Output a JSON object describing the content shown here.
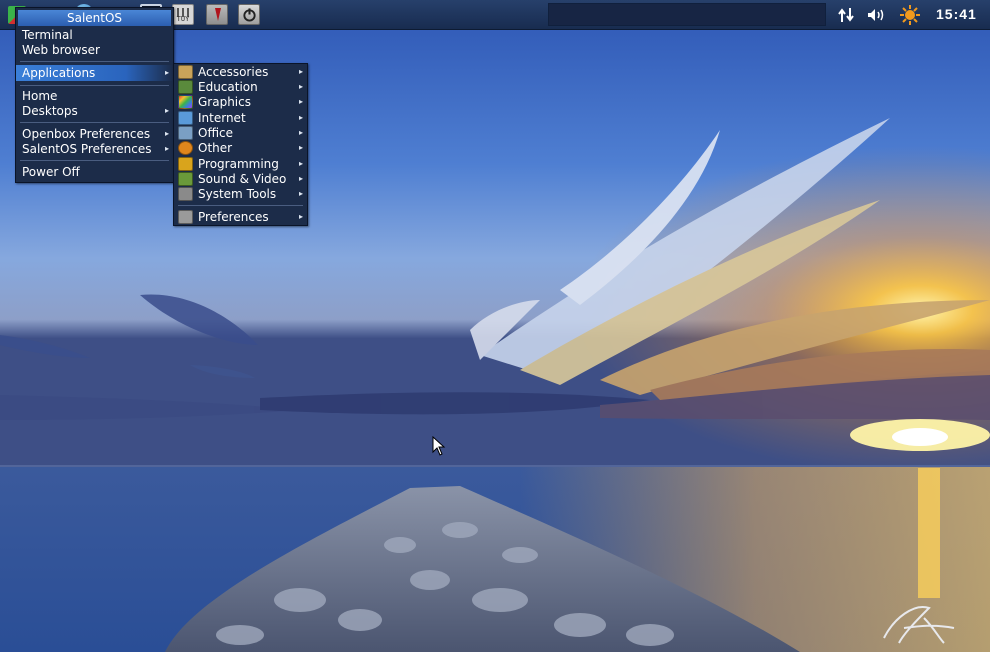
{
  "panel": {
    "launchers": [
      {
        "name": "salentos-logo-icon"
      },
      {
        "name": "web-browser-icon"
      },
      {
        "name": "terminal-icon"
      },
      {
        "name": "tuy-icon",
        "label": "TUY"
      },
      {
        "name": "tie-icon"
      },
      {
        "name": "power-icon"
      }
    ],
    "tray": {
      "network_icon": "network-arrows-icon",
      "volume_icon": "volume-icon",
      "update_icon": "sun-update-icon"
    },
    "clock": "15:41"
  },
  "root_menu": {
    "title": "SalentOS",
    "items": [
      {
        "label": "Terminal",
        "submenu": false
      },
      {
        "label": "Web browser",
        "submenu": false
      },
      {
        "label": "Applications",
        "submenu": true,
        "active": true
      },
      {
        "label": "Home",
        "submenu": false
      },
      {
        "label": "Desktops",
        "submenu": true
      },
      {
        "label": "Openbox Preferences",
        "submenu": true
      },
      {
        "label": "SalentOS Preferences",
        "submenu": true
      },
      {
        "label": "Power Off",
        "submenu": false
      }
    ]
  },
  "applications_menu": {
    "items": [
      {
        "label": "Accessories",
        "icon": "accessories-icon",
        "color": "#c9a35a"
      },
      {
        "label": "Education",
        "icon": "education-icon",
        "color": "#5a8a3c"
      },
      {
        "label": "Graphics",
        "icon": "graphics-icon",
        "color": "#d94a8a"
      },
      {
        "label": "Internet",
        "icon": "internet-icon",
        "color": "#5a9ad9"
      },
      {
        "label": "Office",
        "icon": "office-icon",
        "color": "#7a9fc4"
      },
      {
        "label": "Other",
        "icon": "other-icon",
        "color": "#e0861c"
      },
      {
        "label": "Programming",
        "icon": "programming-icon",
        "color": "#d9a41c"
      },
      {
        "label": "Sound & Video",
        "icon": "sound-video-icon",
        "color": "#6a9a3a"
      },
      {
        "label": "System Tools",
        "icon": "system-tools-icon",
        "color": "#8a8a8a"
      },
      {
        "label": "Preferences",
        "icon": "preferences-icon",
        "color": "#9a9a9a"
      }
    ]
  },
  "colors": {
    "panel": "#1f355d",
    "menu_bg": "#1c2c49",
    "menu_highlight": "#3a7fd8"
  }
}
